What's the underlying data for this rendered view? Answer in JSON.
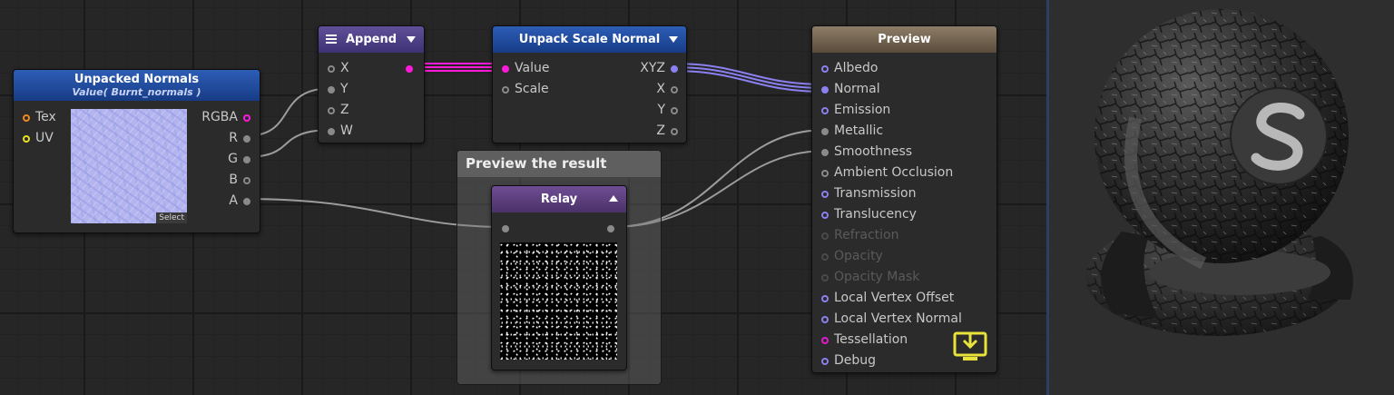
{
  "nodes": {
    "unpacked_normals": {
      "title": "Unpacked Normals",
      "subtitle": "Value( Burnt_normals )",
      "inputs": [
        "Tex",
        "UV"
      ],
      "outputs": [
        "RGBA",
        "R",
        "G",
        "B",
        "A"
      ],
      "select_label": "Select"
    },
    "append": {
      "title": "Append",
      "inputs": [
        "X",
        "Y",
        "Z",
        "W"
      ]
    },
    "unpack_scale_normal": {
      "title": "Unpack Scale Normal",
      "inputs": [
        "Value",
        "Scale"
      ],
      "outputs": [
        "XYZ",
        "X",
        "Y",
        "Z"
      ]
    },
    "relay": {
      "title": "Relay"
    },
    "preview": {
      "title": "Preview",
      "inputs": [
        "Albedo",
        "Normal",
        "Emission",
        "Metallic",
        "Smoothness",
        "Ambient Occlusion",
        "Transmission",
        "Translucency",
        "Refraction",
        "Opacity",
        "Opacity Mask",
        "Local Vertex Offset",
        "Local Vertex Normal",
        "Tessellation",
        "Debug"
      ]
    }
  },
  "group": {
    "title": "Preview the result"
  },
  "colors": {
    "vector4_wire": "#ff1ad9",
    "vector3_wire": "#8a80f0",
    "float_wire": "#9a9a9a",
    "header_blue": "#1f4aa0",
    "header_purple": "#4b3f85",
    "header_preview": "#776752"
  },
  "icons": {
    "save": "download-tray-icon",
    "menu": "hamburger-icon",
    "collapse": "triangle-down-icon",
    "expand": "triangle-up-icon",
    "logo": "s-logo-icon"
  }
}
